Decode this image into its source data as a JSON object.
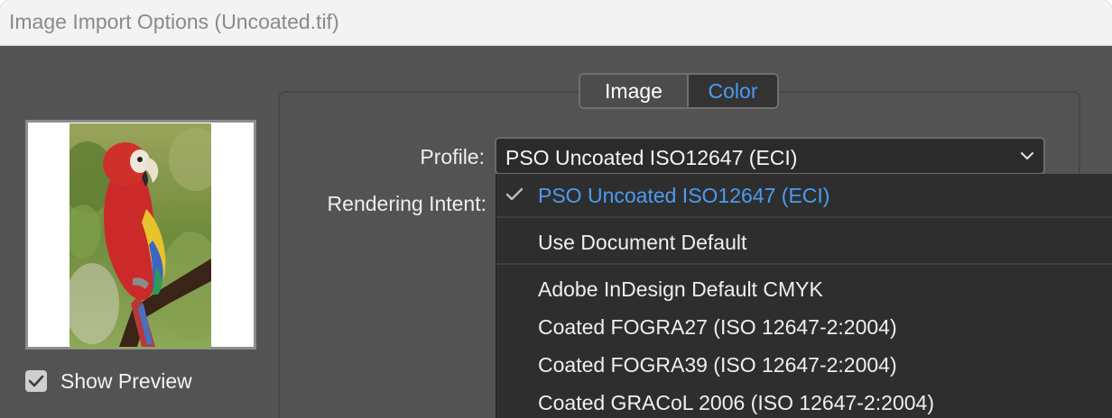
{
  "window": {
    "title": "Image Import Options (Uncoated.tif)"
  },
  "preview": {
    "show_preview_label": "Show Preview",
    "show_preview_checked": true
  },
  "tabs": [
    {
      "label": "Image",
      "active": false
    },
    {
      "label": "Color",
      "active": true
    }
  ],
  "fields": {
    "profile_label": "Profile:",
    "profile_value": "PSO Uncoated ISO12647 (ECI)",
    "rendering_intent_label": "Rendering Intent:"
  },
  "profile_menu": {
    "items": [
      {
        "label": "PSO Uncoated ISO12647 (ECI)",
        "selected": true
      },
      {
        "label": "Use Document Default",
        "selected": false
      },
      {
        "label": "Adobe InDesign Default CMYK",
        "selected": false
      },
      {
        "label": "Coated FOGRA27 (ISO 12647-2:2004)",
        "selected": false
      },
      {
        "label": "Coated FOGRA39 (ISO 12647-2:2004)",
        "selected": false
      },
      {
        "label": "Coated GRACoL 2006 (ISO 12647-2:2004)",
        "selected": false
      }
    ]
  },
  "colors": {
    "accent": "#4b9cf0",
    "dialog_bg": "#535353",
    "menu_bg": "#2e2e2e"
  },
  "icons": {
    "checkbox": "checkmark-icon",
    "selected_item": "check-icon",
    "select_arrow": "chevron-down-icon"
  }
}
